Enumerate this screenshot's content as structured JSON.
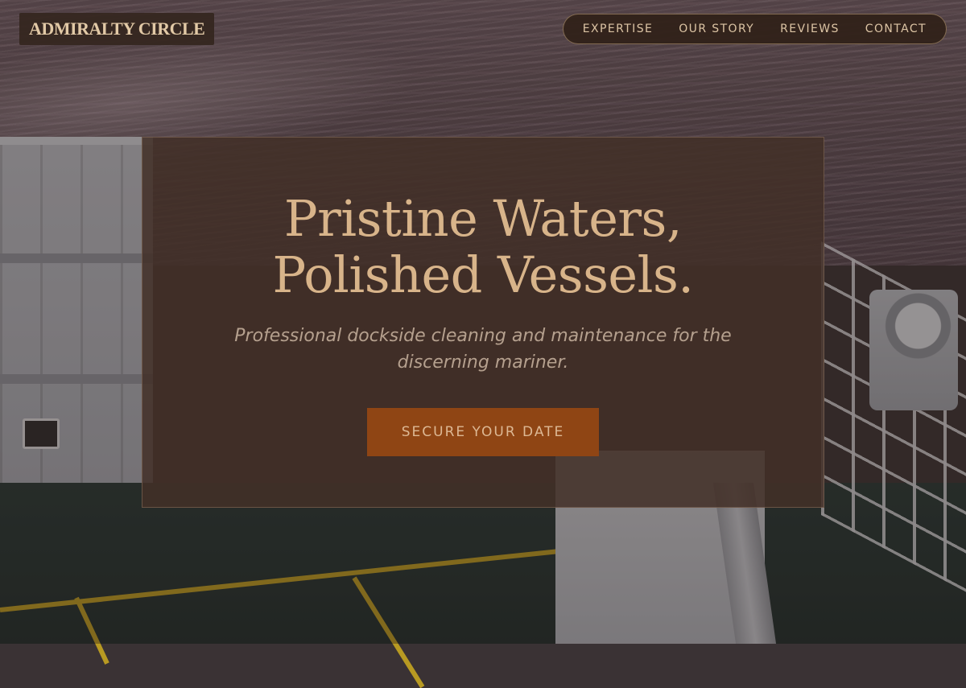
{
  "brand": {
    "name": "ADMIRALTY CIRCLE"
  },
  "nav": {
    "items": [
      {
        "label": "EXPERTISE"
      },
      {
        "label": "OUR STORY"
      },
      {
        "label": "REVIEWS"
      },
      {
        "label": "CONTACT"
      }
    ]
  },
  "hero": {
    "title_line1": "Pristine Waters,",
    "title_line2": "Polished Vessels.",
    "subtitle": "Professional dockside cleaning and maintenance for the discerning mariner.",
    "cta_label": "SECURE YOUR DATE"
  },
  "colors": {
    "accent": "#8f4514",
    "heading": "#d8b48a",
    "nav_text": "#dcc4a4"
  }
}
